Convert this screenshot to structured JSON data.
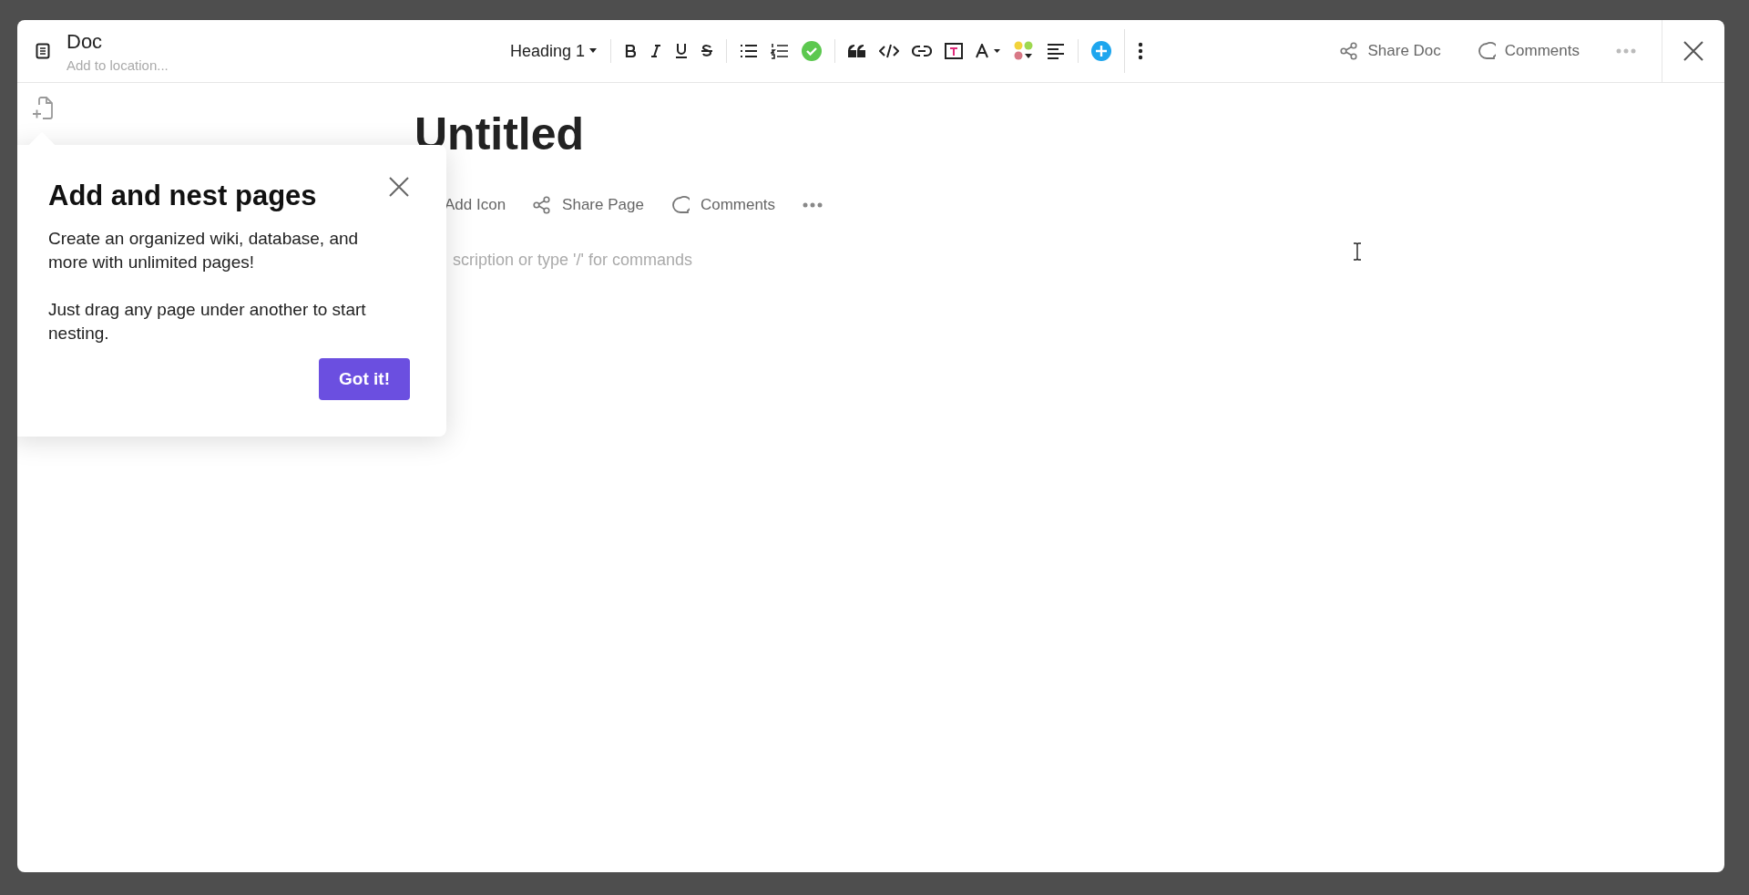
{
  "header": {
    "title": "Doc",
    "location_placeholder": "Add to location...",
    "block_style": "Heading 1"
  },
  "actions": [
    {
      "label": "Share Doc",
      "kind": "share"
    },
    {
      "label": "Comments",
      "kind": "comment"
    }
  ],
  "document": {
    "title": "Untitled",
    "page_actions": [
      {
        "label": "Add Icon",
        "kind": "icon"
      },
      {
        "label": "Share Page",
        "kind": "share"
      },
      {
        "label": "Comments",
        "kind": "comment"
      }
    ],
    "description_placeholder": "scription or type '/' for commands"
  },
  "popover": {
    "title": "Add and nest pages",
    "paragraphs": [
      "Create an organized wiki, database, and more with unlimited pages!",
      "Just drag any page under another to start nesting."
    ],
    "button": "Got it!"
  }
}
